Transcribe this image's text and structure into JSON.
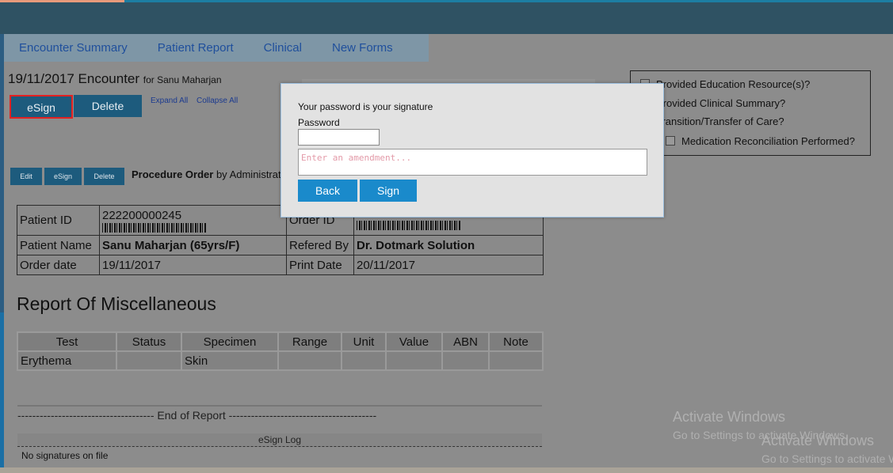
{
  "tabs": [
    "Encounter Summary",
    "Patient Report",
    "Clinical",
    "New Forms"
  ],
  "encounter": {
    "title": "19/11/2017 Encounter",
    "for": "for Sanu Maharjan",
    "esign": "eSign",
    "delete": "Delete",
    "expand_all": "Expand All",
    "collapse_all": "Collapse All"
  },
  "procedure": {
    "edit": "Edit",
    "esign": "eSign",
    "delete": "Delete",
    "title": "Procedure Order",
    "by": "by Administrat"
  },
  "patient_info": {
    "patient_id_label": "Patient ID",
    "patient_id": "222200000245",
    "order_id_label": "Order ID",
    "patient_name_label": "Patient Name",
    "patient_name": "Sanu Maharjan (65yrs/F)",
    "refered_by_label": "Refered By",
    "refered_by": "Dr. Dotmark Solution",
    "order_date_label": "Order date",
    "order_date": "19/11/2017",
    "print_date_label": "Print Date",
    "print_date": "20/11/2017"
  },
  "report": {
    "title": "Report Of Miscellaneous",
    "columns": [
      "Test",
      "Status",
      "Specimen",
      "Range",
      "Unit",
      "Value",
      "ABN",
      "Note"
    ],
    "rows": [
      [
        "Erythema",
        "",
        "Skin",
        "",
        "",
        "",
        "",
        ""
      ]
    ],
    "end_of_report": "------------------------------------- End of Report ----------------------------------------",
    "esign_log": "eSign Log",
    "no_signatures": "No signatures on file"
  },
  "checklist": {
    "items": [
      "Provided Education Resource(s)?",
      "Provided Clinical Summary?",
      "Transition/Transfer of Care?",
      "Medication Reconciliation Performed?"
    ]
  },
  "dialog": {
    "message": "Your password is your signature",
    "password_label": "Password",
    "password_value": "",
    "amendment_placeholder": "Enter an amendment...",
    "back": "Back",
    "sign": "Sign"
  },
  "watermark": {
    "title": "Activate Windows",
    "subtitle": "Go to Settings to activate Windows."
  }
}
